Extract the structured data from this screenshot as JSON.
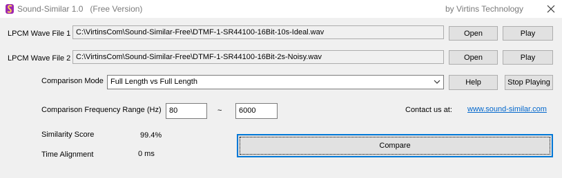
{
  "window": {
    "title": "Sound-Similar 1.0   (Free Version)",
    "company": "by Virtins Technology",
    "icons": {
      "app": "sound-similar-app-icon",
      "close": "close-icon"
    }
  },
  "file1": {
    "label": "LPCM Wave File 1",
    "path": "C:\\VirtinsCom\\Sound-Similar-Free\\DTMF-1-SR44100-16Bit-10s-Ideal.wav",
    "open_label": "Open",
    "play_label": "Play"
  },
  "file2": {
    "label": "LPCM Wave File 2",
    "path": "C:\\VirtinsCom\\Sound-Similar-Free\\DTMF-1-SR44100-16Bit-2s-Noisy.wav",
    "open_label": "Open",
    "play_label": "Play"
  },
  "mode": {
    "label": "Comparison Mode",
    "selected": "Full Length vs Full Length",
    "help_label": "Help",
    "stop_label": "Stop Playing"
  },
  "frequency": {
    "label": "Comparison Frequency Range (Hz)",
    "low": "80",
    "separator": "~",
    "high": "6000"
  },
  "contact": {
    "label": "Contact us at:",
    "link": "www.sound-similar.com"
  },
  "results": {
    "similarity_label": "Similarity Score",
    "similarity_value": "99.4%",
    "alignment_label": "Time Alignment",
    "alignment_value": "0 ms"
  },
  "compare_label": "Compare",
  "colors": {
    "accent": "#0078d7",
    "link": "#0066cc",
    "title_text": "#7a7a7a"
  }
}
